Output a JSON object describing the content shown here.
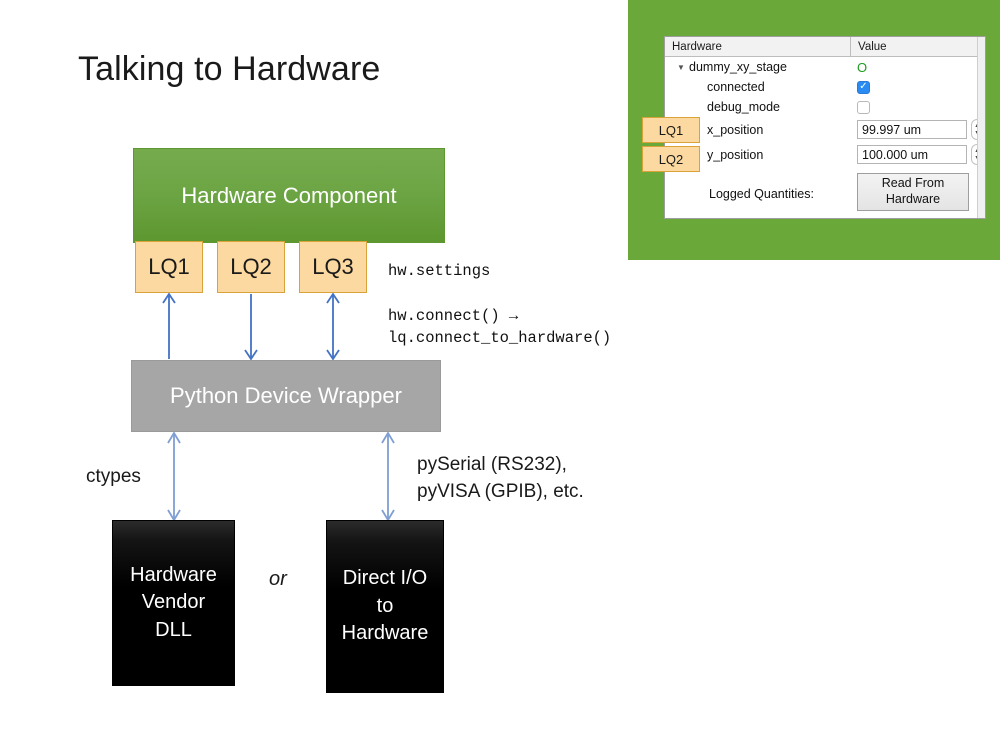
{
  "slide": {
    "title": "Talking to Hardware"
  },
  "diagram": {
    "hardware_component": "Hardware Component",
    "python_wrapper": "Python Device Wrapper",
    "lq_chips": [
      "LQ1",
      "LQ2",
      "LQ3"
    ],
    "code_settings": "hw.settings",
    "code_connect": "hw.connect() →\nlq.connect_to_hardware()",
    "ctypes_label": "ctypes",
    "pyserial_label": "pySerial (RS232),\npyVISA (GPIB), etc.",
    "or_label": "or",
    "vendor_dll": "Hardware\nVendor\nDLL",
    "direct_io": "Direct I/O\nto\nHardware",
    "colors": {
      "hardware_component_green": "#6da545",
      "python_wrapper_grey": "#a6a6a6",
      "lq_chip_fill": "#fbd9a0",
      "lq_chip_border": "#d9a33a",
      "arrow_blue": "#4472c4",
      "arrow_blue_light": "#7f9fd4",
      "black_box": "#000000"
    }
  },
  "screenshot": {
    "background_green": "#6aa83a",
    "tree": {
      "headers": [
        "Hardware",
        "Value"
      ],
      "rows": [
        {
          "name": "dummy_xy_stage",
          "indent": 0,
          "disclosure": "▼",
          "value_type": "status",
          "value": "O"
        },
        {
          "name": "connected",
          "indent": 1,
          "value_type": "checkbox-checked",
          "value": "✓"
        },
        {
          "name": "debug_mode",
          "indent": 1,
          "value_type": "checkbox-unchecked",
          "value": ""
        },
        {
          "name": "x_position",
          "indent": 1,
          "value_type": "spinbox",
          "value": "99.997 um"
        },
        {
          "name": "y_position",
          "indent": 1,
          "value_type": "spinbox",
          "value": "100.000 um"
        }
      ],
      "logged_quantities_label": "Logged Quantities:",
      "read_button_line1": "Read From",
      "read_button_line2": "Hardware"
    },
    "callouts": [
      "LQ1",
      "LQ2"
    ]
  }
}
